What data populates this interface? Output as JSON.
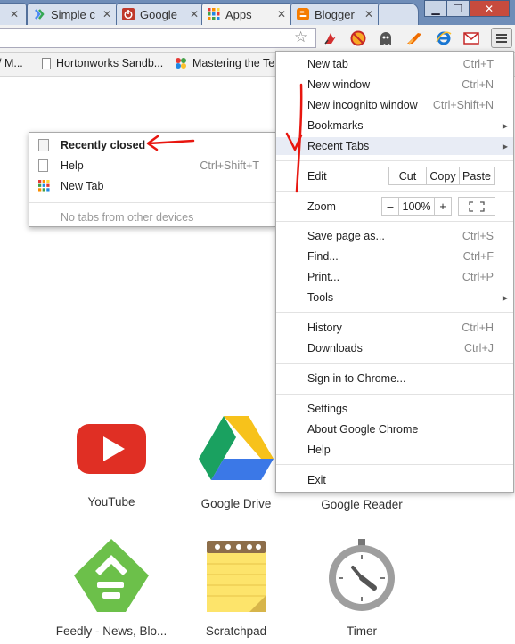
{
  "tabs": [
    {
      "title": "Simple c",
      "icon": "google-blog-icon"
    },
    {
      "title": "Google",
      "icon": "power-icon"
    },
    {
      "title": "Apps",
      "icon": "apps-grid-icon"
    },
    {
      "title": "Blogger",
      "icon": "blogger-icon"
    },
    {
      "title": "",
      "icon": "new-tab-icon"
    }
  ],
  "bookmarks": {
    "partial": "/ M...",
    "hortonworks": "Hortonworks Sandb...",
    "mastering": "Mastering the Te"
  },
  "chrome_menu": {
    "new_tab": "New tab",
    "new_tab_sc": "Ctrl+T",
    "new_window": "New window",
    "new_window_sc": "Ctrl+N",
    "incognito": "New incognito window",
    "incognito_sc": "Ctrl+Shift+N",
    "bookmarks": "Bookmarks",
    "recent_tabs": "Recent Tabs",
    "edit": "Edit",
    "cut": "Cut",
    "copy": "Copy",
    "paste": "Paste",
    "zoom": "Zoom",
    "zoom_minus": "–",
    "zoom_value": "100%",
    "zoom_plus": "+",
    "save_page": "Save page as...",
    "save_page_sc": "Ctrl+S",
    "find": "Find...",
    "find_sc": "Ctrl+F",
    "print": "Print...",
    "print_sc": "Ctrl+P",
    "tools": "Tools",
    "history": "History",
    "history_sc": "Ctrl+H",
    "downloads": "Downloads",
    "downloads_sc": "Ctrl+J",
    "sign_in": "Sign in to Chrome...",
    "settings": "Settings",
    "about": "About Google Chrome",
    "help": "Help",
    "exit": "Exit"
  },
  "recent_menu": {
    "recently_closed": "Recently closed",
    "help": "Help",
    "help_sc": "Ctrl+Shift+T",
    "new_tab": "New Tab",
    "no_tabs": "No tabs from other devices"
  },
  "apps": [
    {
      "label": "YouTube"
    },
    {
      "label": "Google Drive"
    },
    {
      "label": "Google Reader"
    },
    {
      "label": "Feedly - News, Blo..."
    },
    {
      "label": "Scratchpad"
    },
    {
      "label": "Timer"
    }
  ],
  "colors": {
    "annotation": "#e8160f",
    "youtube": "#e02f24",
    "feedly": "#6cc04a"
  }
}
